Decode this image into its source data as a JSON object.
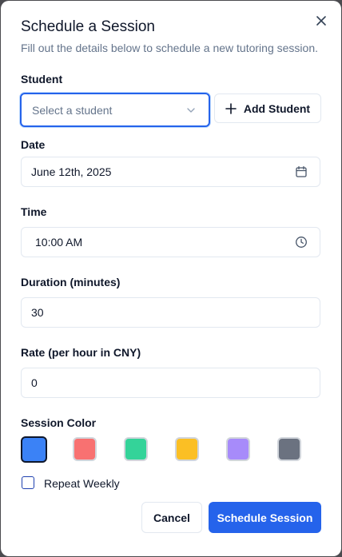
{
  "dialog": {
    "title": "Schedule a Session",
    "description": "Fill out the details below to schedule a new tutoring session.",
    "close_icon": "close-icon"
  },
  "student": {
    "label": "Student",
    "placeholder": "Select a student",
    "add_button_label": "Add Student"
  },
  "date": {
    "label": "Date",
    "value": "June 12th, 2025",
    "icon": "calendar-icon"
  },
  "time": {
    "label": "Time",
    "value": "10:00 AM",
    "icon": "clock-icon"
  },
  "duration": {
    "label": "Duration (minutes)",
    "value": "30"
  },
  "rate": {
    "label": "Rate (per hour in CNY)",
    "value": "0"
  },
  "session_color": {
    "label": "Session Color",
    "options": [
      "#3b82f6",
      "#f87171",
      "#34d399",
      "#fbbf24",
      "#a78bfa",
      "#6b7280"
    ],
    "selected": "#3b82f6"
  },
  "repeat": {
    "label": "Repeat Weekly",
    "checked": false
  },
  "actions": {
    "cancel_label": "Cancel",
    "submit_label": "Schedule Session"
  },
  "colors": {
    "accent": "#2563eb"
  }
}
